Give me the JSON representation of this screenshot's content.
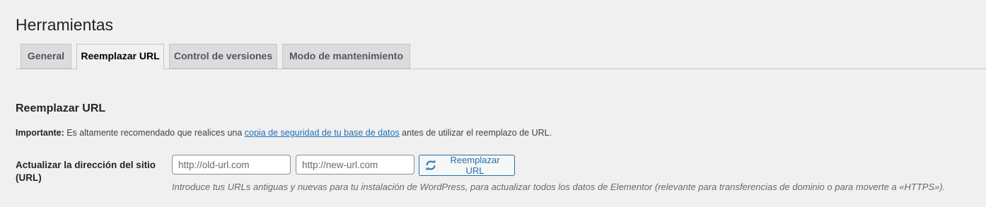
{
  "page": {
    "title": "Herramientas"
  },
  "tabs": [
    {
      "label": "General",
      "active": false
    },
    {
      "label": "Reemplazar URL",
      "active": true
    },
    {
      "label": "Control de versiones",
      "active": false
    },
    {
      "label": "Modo de mantenimiento",
      "active": false
    }
  ],
  "section": {
    "title": "Reemplazar URL",
    "notice": {
      "strong": "Importante:",
      "text_before": " Es altamente recomendado que realices una ",
      "link": "copia de seguridad de tu base de datos",
      "text_after": " antes de utilizar el reemplazo de URL."
    },
    "field": {
      "label": "Actualizar la dirección del sitio (URL)",
      "old_url_placeholder": "http://old-url.com",
      "old_url_value": "",
      "new_url_placeholder": "http://new-url.com",
      "new_url_value": "",
      "button_label": "Reemplazar URL",
      "button_icon": "refresh-icon",
      "description": "Introduce tus URLs antiguas y nuevas para tu instalación de WordPress, para actualizar todos los datos de Elementor (relevante para transferencias de dominio o para moverte a «HTTPS»)."
    }
  },
  "colors": {
    "background": "#f0f0f1",
    "link": "#2271b1",
    "tab_inactive": "#dcdcde",
    "border": "#c3c4c7"
  }
}
